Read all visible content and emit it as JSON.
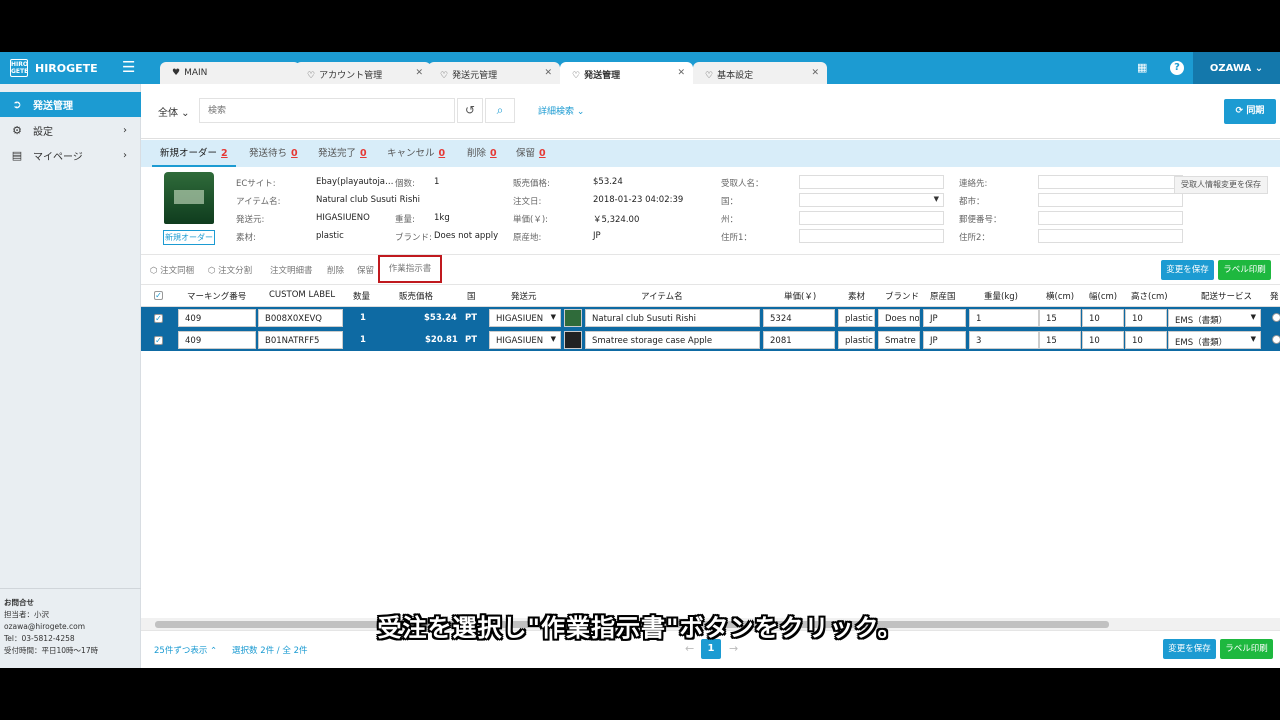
{
  "app": {
    "title": "HIROGETE",
    "logo_text": "HIRO GETE"
  },
  "tabs": [
    {
      "label": "MAIN"
    },
    {
      "label": "アカウント管理"
    },
    {
      "label": "発送元管理"
    },
    {
      "label": "発送管理"
    },
    {
      "label": "基本設定"
    }
  ],
  "user": {
    "name": "OZAWA ⌄"
  },
  "sidebar": {
    "items": [
      {
        "label": "発送管理"
      },
      {
        "label": "設定"
      },
      {
        "label": "マイページ"
      }
    ],
    "contact": {
      "heading": "お問合せ",
      "person": "担当者：小沢",
      "email": "ozawa@hirogete.com",
      "tel": "Tel：03-5812-4258",
      "hours": "受付時間：平日10時〜17時"
    }
  },
  "search": {
    "filter": "全体 ⌄",
    "placeholder": "検索",
    "advanced": "詳細検索 ⌄",
    "sync": "⟳ 同期"
  },
  "order_tabs": [
    {
      "label": "新規オーダー",
      "count": "2"
    },
    {
      "label": "発送待ち",
      "count": "0"
    },
    {
      "label": "発送完了",
      "count": "0"
    },
    {
      "label": "キャンセル",
      "count": "0"
    },
    {
      "label": "削除",
      "count": "0"
    },
    {
      "label": "保留",
      "count": "0"
    }
  ],
  "detail": {
    "status_button": "新規オーダー",
    "labels": {
      "ec_site": "ECサイト:",
      "item_name": "アイテム名:",
      "origin": "発送元:",
      "material": "素材:",
      "qty": "個数:",
      "weight": "重量:",
      "brand": "ブランド:",
      "price": "販売価格:",
      "order_date": "注文日:",
      "unit_price": "単価(￥):",
      "country_of_origin": "原産地:",
      "recipient": "受取人名：",
      "country": "国：",
      "state": "州：",
      "address1": "住所1：",
      "contact": "連絡先:",
      "city": "都市：",
      "postal": "郵便番号：",
      "address2": "住所2："
    },
    "values": {
      "ec_site": "Ebay(playautoja…",
      "item_name": "Natural club Susuti Rishi",
      "origin": "HIGASIUENO",
      "material": "plastic",
      "qty": "1",
      "weight": "1kg",
      "brand": "Does not apply",
      "price": "$53.24",
      "order_date": "2018-01-23 04:02:39",
      "unit_price": "￥5,324.00",
      "country_of_origin": "JP"
    },
    "recipient_button": "受取人情報変更を保存"
  },
  "actions": {
    "merge": "注文同梱",
    "split": "注文分割",
    "details": "注文明細書",
    "delete": "削除",
    "hold": "保留",
    "work_order": "作業指示書",
    "save": "変更を保存",
    "print": "ラベル印刷"
  },
  "table": {
    "headers": [
      "マーキング番号",
      "CUSTOM LABEL",
      "数量",
      "販売価格",
      "国",
      "発送元",
      "アイテム名",
      "単価(￥)",
      "素材",
      "ブランド",
      "原産国",
      "重量(kg)",
      "横(cm)",
      "幅(cm)",
      "高さ(cm)",
      "配送サービス",
      "発"
    ],
    "rows": [
      {
        "marking": "409",
        "custom_label": "B008X0XEVQ",
        "qty": "1",
        "price": "$53.24",
        "country": "PT",
        "origin": "HIGASIUEN",
        "item": "Natural club Susuti Rishi",
        "unit": "5324",
        "material": "plastic",
        "brand": "Does no",
        "coo": "JP",
        "weight": "1",
        "w": "15",
        "d": "10",
        "h": "10",
        "service": "EMS（書類）"
      },
      {
        "marking": "409",
        "custom_label": "B01NATRFF5",
        "qty": "1",
        "price": "$20.81",
        "country": "PT",
        "origin": "HIGASIUEN",
        "item": "Smatree storage case Apple",
        "unit": "2081",
        "material": "plastic",
        "brand": "Smatre",
        "coo": "JP",
        "weight": "3",
        "w": "15",
        "d": "10",
        "h": "10",
        "service": "EMS（書類）"
      }
    ]
  },
  "footer": {
    "per_page": "25件ずつ表示 ⌃",
    "selected": "選択数 2件 / 全 2件",
    "page": "1",
    "save": "変更を保存",
    "print": "ラベル印刷"
  },
  "caption": "受注を選択し\"作業指示書\"ボタンをクリック。",
  "colors": {
    "primary": "#1c9bd2",
    "row_selected": "#0e6aa3",
    "print": "#1eb83f",
    "highlight": "#c0191e",
    "count": "#e53935"
  }
}
